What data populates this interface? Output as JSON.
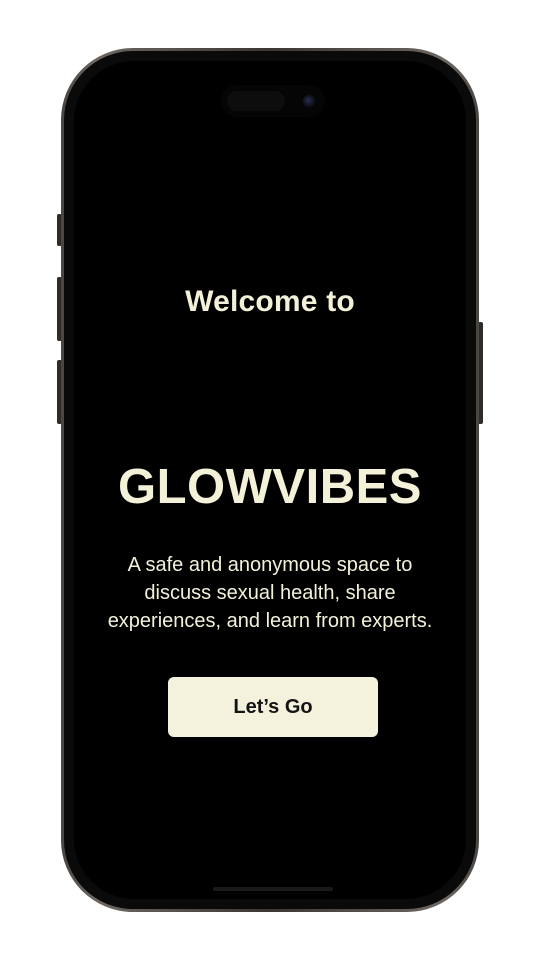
{
  "welcome": {
    "heading": "Welcome to",
    "app_name": "GLOWVIBES",
    "tagline": "A safe and anonymous space to discuss sexual health, share experiences, and learn from experts.",
    "cta_label": "Let’s Go"
  },
  "colors": {
    "background": "#000000",
    "text": "#f4f1d9",
    "button_bg": "#f4f2dc",
    "button_text": "#141414"
  }
}
